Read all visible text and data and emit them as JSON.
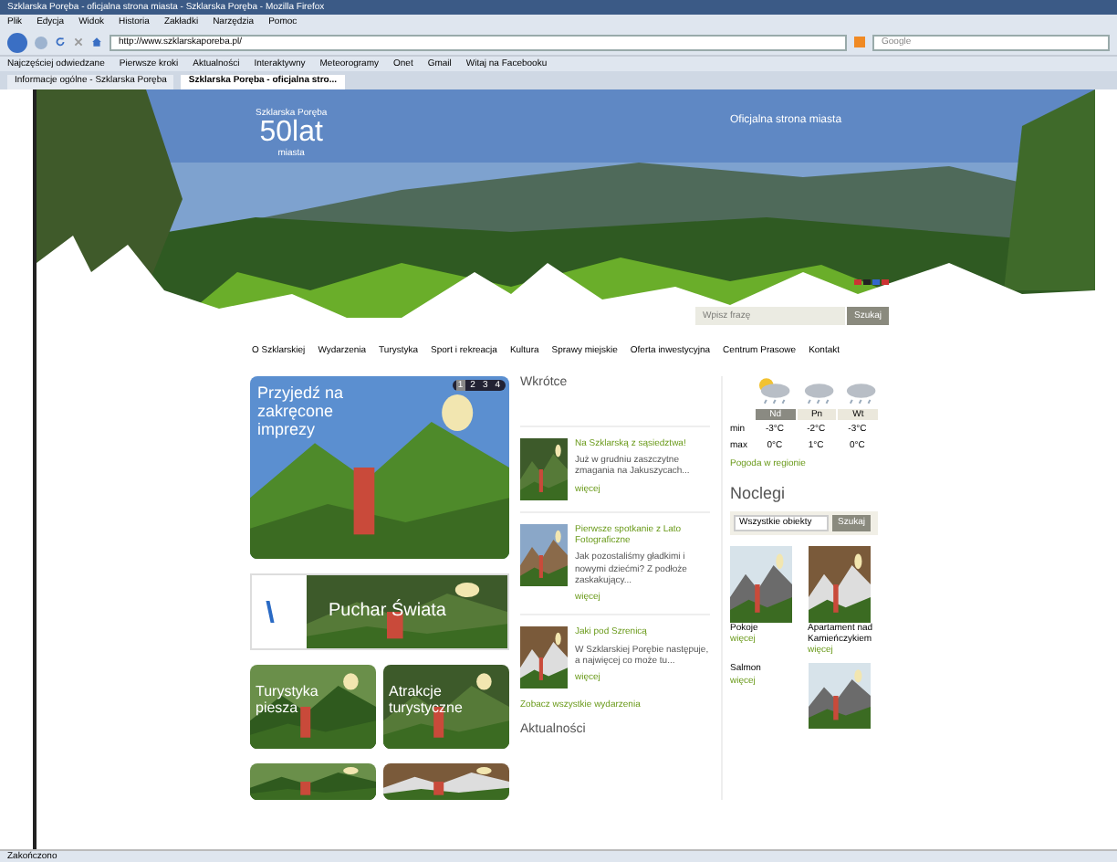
{
  "window": {
    "title": "Szklarska Poręba - oficjalna strona miasta - Szklarska Poręba - Mozilla Firefox"
  },
  "menu": [
    "Plik",
    "Edycja",
    "Widok",
    "Historia",
    "Zakładki",
    "Narzędzia",
    "Pomoc"
  ],
  "address_bar": {
    "value": "http://www.szklarskaporeba.pl/"
  },
  "search_bar": {
    "placeholder": "Google"
  },
  "bookmarks": [
    "Najczęściej odwiedzane",
    "Pierwsze kroki",
    "Aktualności",
    "Interaktywny",
    "Meteorogramy",
    "Onet",
    "Gmail",
    "Witaj na Facebooku"
  ],
  "tabs": [
    {
      "label": "Informacje ogólne - Szklarska Poręba",
      "selected": false
    },
    {
      "label": "Szklarska Poręba - oficjalna stro...",
      "selected": true
    }
  ],
  "header": {
    "logo_name": "Szklarska Poręba",
    "logo_big": "50lat",
    "logo_small": "miasta",
    "tagline": "Oficjalna strona miasta"
  },
  "site_search": {
    "placeholder": "Wpisz frazę",
    "button": "Szukaj"
  },
  "nav": [
    "O Szklarskiej",
    "Wydarzenia",
    "Turystyka",
    "Sport i rekreacja",
    "Kultura",
    "Sprawy miejskie",
    "Oferta inwestycyjna",
    "Centrum Prasowe",
    "Kontakt"
  ],
  "slider": {
    "caption": "Przyjedź na zakręcone imprezy",
    "pages": [
      {
        "label": "1",
        "selected": true
      },
      {
        "label": "2",
        "selected": false
      },
      {
        "label": "3",
        "selected": false
      },
      {
        "label": "4",
        "selected": false
      }
    ]
  },
  "banners": [
    "Puchar Świata",
    "Turystyka piesza",
    "Atrakcje turystyczne"
  ],
  "events": {
    "title": "Wkrótce",
    "items": [
      {
        "title": "Na Szklarską z sąsiedztwa!",
        "text": "Już w grudniu zaszczytne zmagania na Jakuszycach...",
        "more": "więcej"
      },
      {
        "title": "Pierwsze spotkanie z Lato Fotograficzne",
        "text": "Jak pozostaliśmy gładkimi i nowymi dziećmi? Z podłoże zaskakujący...",
        "more": "więcej"
      },
      {
        "title": "Jaki pod Szrenicą",
        "text": "W Szklarskiej Porębie następuje, a najwięcej co może tu...",
        "more": "więcej"
      }
    ],
    "all_link": "Zobacz wszystkie wydarzenia",
    "next_title": "Aktualności"
  },
  "weather": {
    "days": [
      {
        "label": "Nd",
        "selected": true
      },
      {
        "label": "Pn",
        "selected": false
      },
      {
        "label": "Wt",
        "selected": false
      }
    ],
    "rows": [
      {
        "label": "min",
        "values": [
          "-3°C",
          "-2°C",
          "-3°C"
        ]
      },
      {
        "label": "max",
        "values": [
          "0°C",
          "1°C",
          "0°C"
        ]
      }
    ],
    "link": "Pogoda w regionie"
  },
  "lodging": {
    "title": "Noclegi",
    "select": "Wszystkie obiekty",
    "button": "Szukaj",
    "items": [
      {
        "name": "Pokoje",
        "more": "więcej"
      },
      {
        "name": "Apartament nad Kamieńczykiem",
        "more": "więcej"
      },
      {
        "name": "Salmon",
        "more": "więcej"
      },
      {
        "kind": "picture"
      }
    ]
  },
  "status_bar": "Zakończono"
}
